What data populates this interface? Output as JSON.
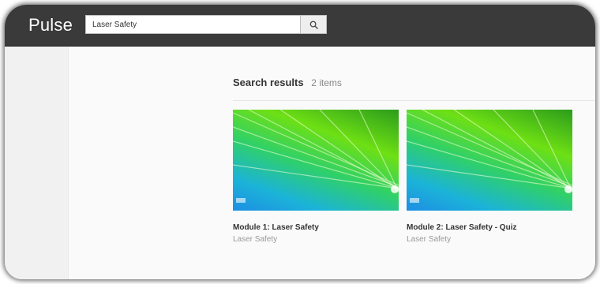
{
  "app": {
    "title": "Pulse"
  },
  "search": {
    "value": "Laser Safety",
    "placeholder": ""
  },
  "results": {
    "title": "Search results",
    "count": "2 items",
    "items": [
      {
        "title": "Module 1: Laser Safety",
        "subtitle": "Laser Safety"
      },
      {
        "title": "Module 2: Laser Safety - Quiz",
        "subtitle": "Laser Safety"
      }
    ]
  },
  "icons": {
    "search_button": "search-icon"
  },
  "colors": {
    "topbar": "#3a3a3a",
    "accent_green": "#6ee014",
    "accent_blue": "#1e8ee3"
  }
}
